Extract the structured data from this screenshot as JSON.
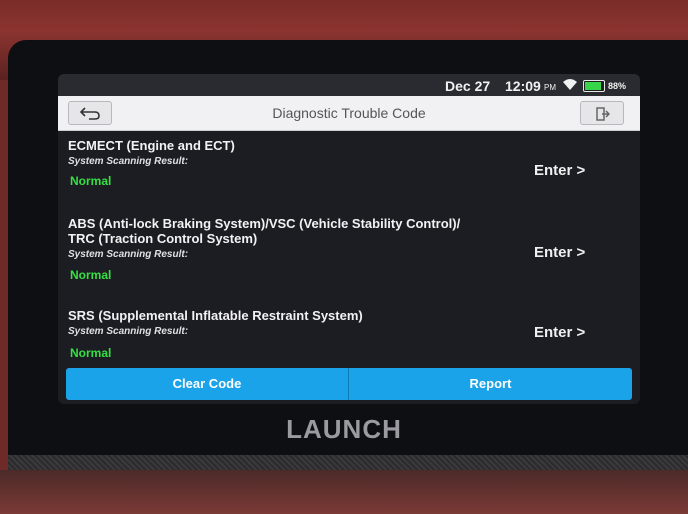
{
  "status_bar": {
    "date": "Dec 27",
    "time": "12:09",
    "ampm": "PM",
    "wifi_icon": "wifi-icon",
    "battery_percent": "88%",
    "battery_level": 0.88,
    "battery_color": "#37d64a"
  },
  "header": {
    "back_icon": "back-arrow-icon",
    "title": "Diagnostic Trouble Code",
    "exit_icon": "exit-icon"
  },
  "systems": [
    {
      "name_line1": "ECMECT (Engine and ECT)",
      "name_line2": "",
      "result_label": "System Scanning Result:",
      "status": "Normal",
      "enter_label": "Enter >"
    },
    {
      "name_line1": "ABS (Anti-lock Braking System)/VSC (Vehicle Stability Control)/",
      "name_line2": "TRC (Traction Control System)",
      "result_label": "System Scanning Result:",
      "status": "Normal",
      "enter_label": "Enter >"
    },
    {
      "name_line1": "SRS (Supplemental Inflatable Restraint System)",
      "name_line2": "",
      "result_label": "System Scanning Result:",
      "status": "Normal",
      "enter_label": "Enter >"
    }
  ],
  "actions": {
    "clear_code": "Clear Code",
    "report": "Report",
    "accent_color": "#1aa3e8"
  },
  "device": {
    "brand": "LAUNCH"
  },
  "colors": {
    "status_normal": "#35e043",
    "screen_bg": "#1c1d22"
  }
}
